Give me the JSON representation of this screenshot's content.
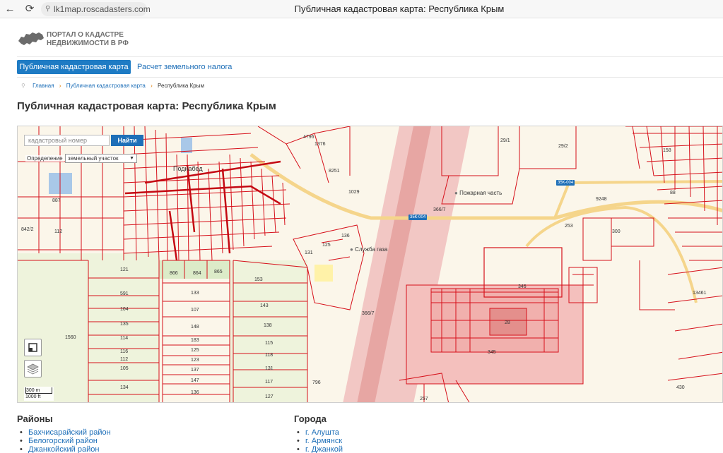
{
  "browser": {
    "back_icon": "arrow-left-icon",
    "reload_icon": "reload-icon",
    "url": "lk1map.roscadasters.com",
    "tab_title": "Публичная кадастровая карта: Республика Крым"
  },
  "header": {
    "logo_line1": "ПОРТАЛ О КАДАСТРЕ",
    "logo_line2": "НЕДВИЖИМОСТИ В РФ"
  },
  "nav": {
    "items": [
      {
        "label": "Публичная кадастровая карта",
        "active": true
      },
      {
        "label": "Расчет земельного налога",
        "active": false
      }
    ]
  },
  "breadcrumb": [
    "Главная",
    "Публичная кадастровая карта",
    "Республика Крым"
  ],
  "page_title": "Публичная кадастровая карта: Республика Крым",
  "map": {
    "search_placeholder": "кадастровый номер",
    "search_button": "Найти",
    "definition_label": "Определение",
    "definition_value": "земельный участок",
    "scale_metric": "300 m",
    "scale_imperial": "1000 ft",
    "place_label": "Поднабед",
    "poi_fire": "Пожарная часть",
    "poi_gas": "Служба газа",
    "road_badges": [
      "35К-004",
      "35К-004"
    ],
    "parcel_labels": [
      "1376",
      "8251",
      "29/1",
      "29/2",
      "887",
      "842/2",
      "112",
      "121",
      "866",
      "864",
      "865",
      "591",
      "104",
      "135",
      "114",
      "116",
      "112",
      "105",
      "134",
      "1560",
      "133",
      "107",
      "148",
      "183",
      "125",
      "123",
      "137",
      "147",
      "136",
      "153",
      "143",
      "138",
      "115",
      "118",
      "131",
      "117",
      "127",
      "366/7",
      "366/7",
      "131",
      "125",
      "136",
      "9248",
      "253",
      "300",
      "346",
      "28",
      "345",
      "13461",
      "88",
      "158",
      "430",
      "257",
      "796",
      "1029",
      "4796"
    ]
  },
  "districts": {
    "title": "Районы",
    "items": [
      "Бахчисарайский район",
      "Белогорский район",
      "Джанкойский район"
    ]
  },
  "cities": {
    "title": "Города",
    "items": [
      "г. Алушта",
      "г. Армянск",
      "г. Джанкой"
    ]
  },
  "colors": {
    "accent": "#1e7bc4",
    "link": "#1e6fb8",
    "parcel_line": "#d6101a",
    "runway": "#f2b3b3",
    "map_bg": "#fbf6ea"
  }
}
